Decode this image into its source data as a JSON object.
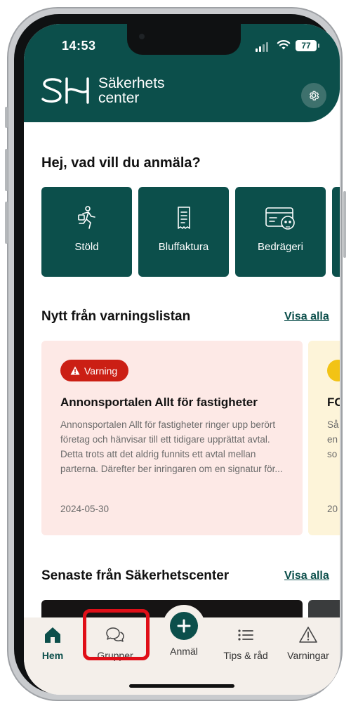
{
  "status": {
    "time": "14:53",
    "battery": "77"
  },
  "brand": {
    "line1": "Säkerhets",
    "line2": "center",
    "mark": "SH"
  },
  "greeting": "Hej, vad vill du anmäla?",
  "categories": [
    {
      "label": "Stöld",
      "icon": "running-thief-icon"
    },
    {
      "label": "Bluffaktura",
      "icon": "receipt-icon"
    },
    {
      "label": "Bedrägeri",
      "icon": "card-skull-icon"
    }
  ],
  "warnings": {
    "title": "Nytt från varningslistan",
    "see_all": "Visa alla",
    "cards": [
      {
        "badge": "Varning",
        "title": "Annonsportalen Allt för fastigheter",
        "body": "Annonsportalen Allt för fastigheter ringer upp berört företag och hänvisar till ett tidigare upprättat avtal. Detta trots att det aldrig funnits ett avtal mellan parterna. Därefter ber inringaren om en signatur för...",
        "date": "2024-05-30"
      },
      {
        "title": "FO",
        "body_lines": [
          "Så",
          "en",
          "so"
        ],
        "date": "20"
      }
    ]
  },
  "latest": {
    "title": "Senaste från Säkerhetscenter",
    "see_all": "Visa alla"
  },
  "tabs": [
    {
      "label": "Hem",
      "icon": "home-icon"
    },
    {
      "label": "Grupper",
      "icon": "chat-bubbles-icon"
    },
    {
      "label": "Anmäl",
      "icon": "plus-icon"
    },
    {
      "label": "Tips & råd",
      "icon": "list-icon"
    },
    {
      "label": "Varningar",
      "icon": "warning-triangle-icon"
    }
  ],
  "colors": {
    "brand": "#0c4f4b",
    "warning_bg": "#fde9e6",
    "warning_badge": "#cb1f14",
    "highlight": "#e00f18"
  }
}
